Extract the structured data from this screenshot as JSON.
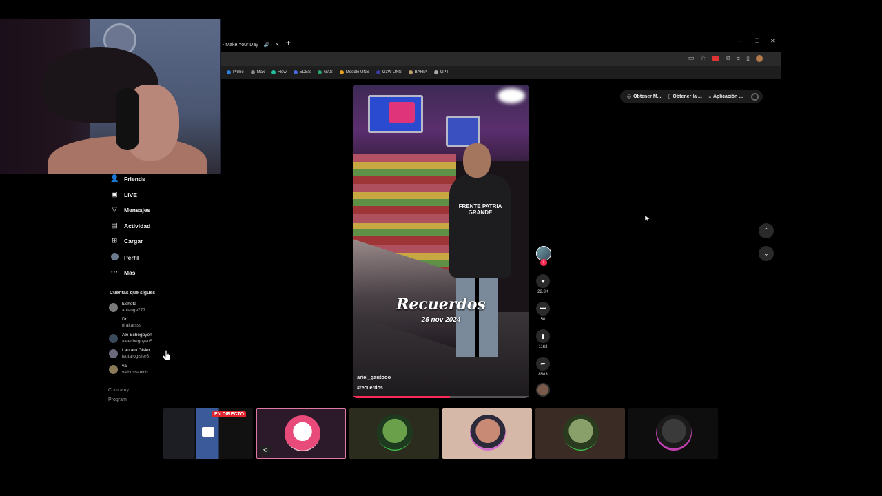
{
  "browser": {
    "tab_title": "- Make Your Day",
    "new_tab": "+",
    "window_controls": [
      "–",
      "❐",
      "✕"
    ],
    "bookmarks": [
      {
        "label": "Prime",
        "color": "#2d7fe0"
      },
      {
        "label": "Max",
        "color": "#888888"
      },
      {
        "label": "Flow",
        "color": "#22c0a0"
      },
      {
        "label": "EDES",
        "color": "#4a6ae0"
      },
      {
        "label": "GAS",
        "color": "#2aa06a"
      },
      {
        "label": "Moodle UNS",
        "color": "#e8a020"
      },
      {
        "label": "G3W UNS",
        "color": "#3a3aa0"
      },
      {
        "label": "BAHIA",
        "color": "#c0a070"
      },
      {
        "label": "GPT",
        "color": "#aaaaaa"
      }
    ]
  },
  "sidebar": {
    "items": [
      {
        "label": "Friends",
        "icon": "friends-icon",
        "glyph": "👤"
      },
      {
        "label": "LIVE",
        "icon": "live-icon",
        "glyph": "▣"
      },
      {
        "label": "Mensajes",
        "icon": "messages-icon",
        "glyph": "▽"
      },
      {
        "label": "Actividad",
        "icon": "activity-icon",
        "glyph": "▤"
      },
      {
        "label": "Cargar",
        "icon": "upload-icon",
        "glyph": "⊞"
      },
      {
        "label": "Perfil",
        "icon": "profile-icon",
        "glyph": ""
      },
      {
        "label": "Más",
        "icon": "more-icon",
        "glyph": "···"
      }
    ],
    "following_title": "Cuentas que sigues",
    "accounts": [
      {
        "name": "luchota",
        "handle": "anianga777"
      },
      {
        "name": "Dr",
        "handle": "drakarsss"
      },
      {
        "name": "Ale Echegoyen",
        "handle": "aleechegoyen5"
      },
      {
        "name": "Lautaro Gisler",
        "handle": "lautarogisler6"
      },
      {
        "name": "val",
        "handle": "valbussanich"
      }
    ],
    "footer": [
      "Company",
      "Program"
    ]
  },
  "top_actions": [
    {
      "label": "Obtener M...",
      "icon": "coin-icon",
      "glyph": "◎"
    },
    {
      "label": "Obtener la ...",
      "icon": "phone-icon",
      "glyph": "▯"
    },
    {
      "label": "Aplicación ...",
      "icon": "download-icon",
      "glyph": "⤓"
    }
  ],
  "video": {
    "title": "Recuerdos",
    "date": "25 nov 2024",
    "shirt_text": "FRENTE PATRIA GRANDE",
    "author": "ariel_gautooo",
    "hashtag": "#recuerdos",
    "progress": 0.55
  },
  "actions": {
    "likes": "22.8K",
    "comments": "50",
    "saves": "1162",
    "shares": "8583"
  },
  "stream_bar": {
    "live_label": "EN DIRECTO"
  }
}
